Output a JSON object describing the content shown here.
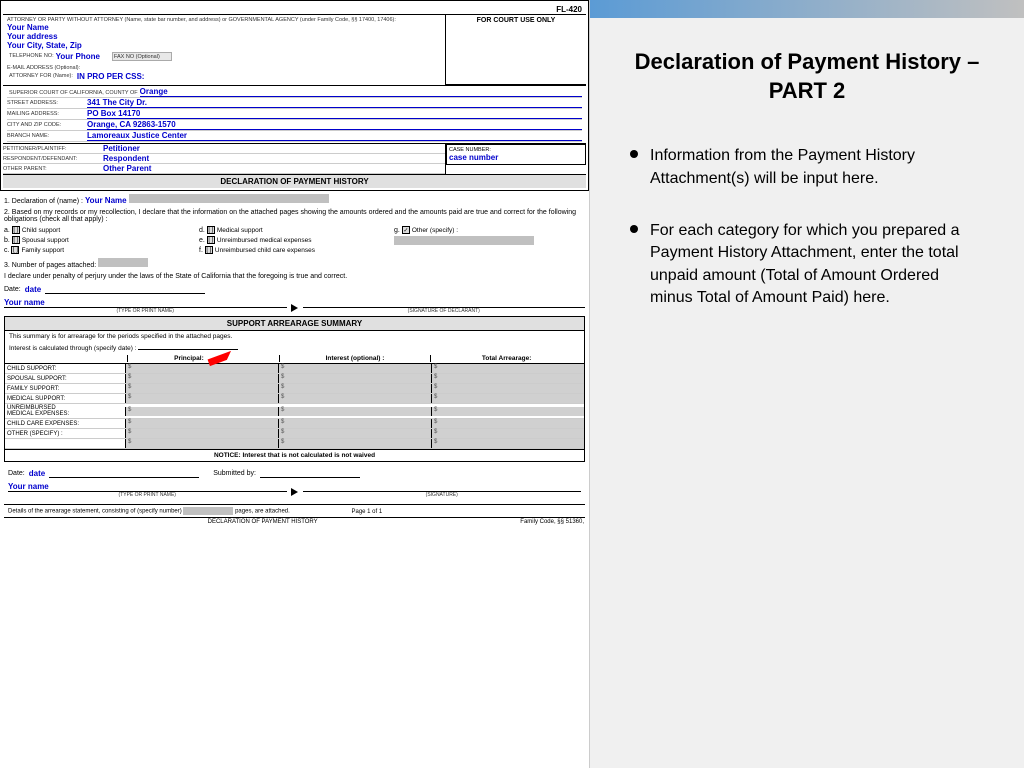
{
  "doc": {
    "form_number": "FL-420",
    "header": {
      "attorney_label": "ATTORNEY OR PARTY WITHOUT ATTORNEY   (Name, state bar number, and address) or GOVERNMENTAL AGENCY (under Family Code, §§ 17400, 17406):",
      "for_court_use": "FOR COURT USE ONLY",
      "name": "Your Name",
      "address": "Your address",
      "city_state_zip": "Your City, State, Zip",
      "telephone_label": "TELEPHONE NO:",
      "telephone": "Your Phone",
      "fax_label": "FAX NO (Optional):",
      "fax_placeholder": "FAX NO (Optional)",
      "email_label": "E-MAIL ADDRESS (Optional):",
      "attorney_for_label": "ATTORNEY FOR (Name):",
      "attorney_for": "IN PRO PER  CSS:"
    },
    "court": {
      "superior_court_label": "SUPERIOR COURT OF CALIFORNIA, COUNTY OF",
      "county": "Orange",
      "street_label": "STREET ADDRESS:",
      "street": "341 The City Dr.",
      "mailing_label": "MAILING ADDRESS:",
      "mailing": "PO Box 14170",
      "city_zip_label": "CITY AND ZIP CODE:",
      "city_zip": "Orange, CA  92863-1570",
      "branch_label": "BRANCH NAME:",
      "branch": "Lamoreaux Justice Center"
    },
    "parties": {
      "petitioner_label": "PETITIONER/PLAINTIFF:",
      "petitioner": "Petitioner",
      "respondent_label": "RESPONDENT/DEFENDANT:",
      "respondent": "Respondent",
      "other_parent_label": "OTHER PARENT:",
      "other_parent": "Other Parent"
    },
    "case_number_label": "CASE NUMBER:",
    "case_number": "case number",
    "declaration_title": "DECLARATION OF PAYMENT HISTORY",
    "body": {
      "item1_prefix": "1.  Declaration of (name) :",
      "item1_name": "Your Name",
      "item2": "2.  Based on my records or my recollection, I declare that the information on the attached pages showing the amounts ordered and the amounts paid are true and correct for the following obligations (check all that apply) :",
      "checkboxes": [
        {
          "id": "a",
          "label": "Child support",
          "col": "d",
          "col_label": "Medical support",
          "col2": "g",
          "col2_label": "Other (specify) :"
        },
        {
          "id": "b",
          "label": "Spousal support",
          "col": "e",
          "col_label": "Unreimbursed medical expenses"
        },
        {
          "id": "c",
          "label": "Family support",
          "col": "f",
          "col_label": "Unreimbursed child care expenses"
        }
      ],
      "item3": "3.  Number of pages attached:",
      "perjury_text": "I declare under penalty of perjury under the laws of the State of California that the foregoing is true and correct.",
      "date_label": "Date:",
      "date_value": "date",
      "your_name_label": "Your name",
      "type_print_label": "(TYPE OR PRINT NAME)",
      "signature_label": "(SIGNATURE OF DECLARANT)"
    },
    "summary": {
      "title": "SUPPORT ARREARAGE SUMMARY",
      "intro": "This summary is for arrearage for the periods specified in the attached pages.",
      "interest_label": "Interest is calculated through (specify date) :",
      "columns": {
        "principal": "Principal:",
        "interest": "Interest (optional) :",
        "total": "Total Arrearage:"
      },
      "rows": [
        {
          "label": "CHILD SUPPORT:"
        },
        {
          "label": "SPOUSAL SUPPORT:"
        },
        {
          "label": "FAMILY SUPPORT:"
        },
        {
          "label": "MEDICAL SUPPORT:"
        },
        {
          "label": "UNREIMBURSED\n  MEDICAL EXPENSES:"
        },
        {
          "label": "  CHILD CARE EXPENSES:"
        },
        {
          "label": "OTHER (specify) :"
        },
        {
          "label": ""
        }
      ],
      "notice": "NOTICE: Interest that is not calculated is not waived",
      "date_label": "Date:",
      "date_value": "date",
      "submitted_by": "Submitted by:",
      "your_name": "Your name",
      "type_print_label": "(TYPE OR PRINT NAME)",
      "signature_label": "(SIGNATURE)"
    },
    "footer": {
      "details_text": "Details of the arrearage statement, consisting of (specify number)",
      "pages_text": "pages, are attached.",
      "page_ref": "Page 1 of 1",
      "bottom_title": "DECLARATION OF PAYMENT HISTORY",
      "family_code": "Family Code, §§ 51360,"
    }
  },
  "slide": {
    "title": "Declaration of Payment History – PART 2",
    "bullets": [
      "Information from the Payment History Attachment(s) will be input here.",
      "For each category for which you prepared a Payment History Attachment, enter the total unpaid amount (Total of Amount Ordered minus Total of Amount Paid) here."
    ]
  }
}
